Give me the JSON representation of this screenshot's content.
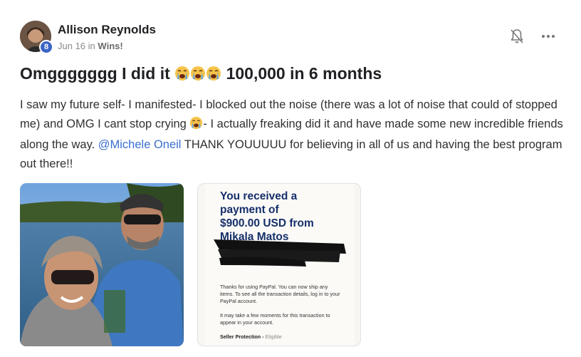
{
  "post": {
    "author": "Allison Reynolds",
    "level": "8",
    "date": "Jun 16",
    "in_text": "in",
    "category": "Wins!",
    "title": "Omggggggg I did it",
    "title_tail": "100,000 in 6 months",
    "body": {
      "part1": "I saw my future self- I manifested- I blocked out the noise (there was a lot of noise that could of stopped me) and OMG I cant stop crying ",
      "part2": "- I actually freaking did it and have made some new incredible friends along the way. ",
      "mention": "@Michele Oneil",
      "part3": " THANK YOUUUUU for believing in all of us and having the best program out there!!"
    }
  },
  "receipt": {
    "line1": "You received a",
    "line2": "payment of",
    "line3": "$900.00 USD from",
    "line4": "Mikala Matos",
    "thanks": "Thanks for using PayPal. You can now ship any items. To see all the transaction details, log in to your PayPal account.",
    "moments": "It may take a few moments for this transaction to appear in your account.",
    "seller_protection": "Seller Protection -",
    "eligible": "Eligible"
  },
  "icons": {
    "bell": "bell-off-icon",
    "more": "more-horizontal-icon",
    "emoji": "loudly-crying-face-emoji"
  },
  "colors": {
    "mention": "#3a6fd0",
    "badge": "#3b64c6",
    "paypal_navy": "#162f6a"
  }
}
